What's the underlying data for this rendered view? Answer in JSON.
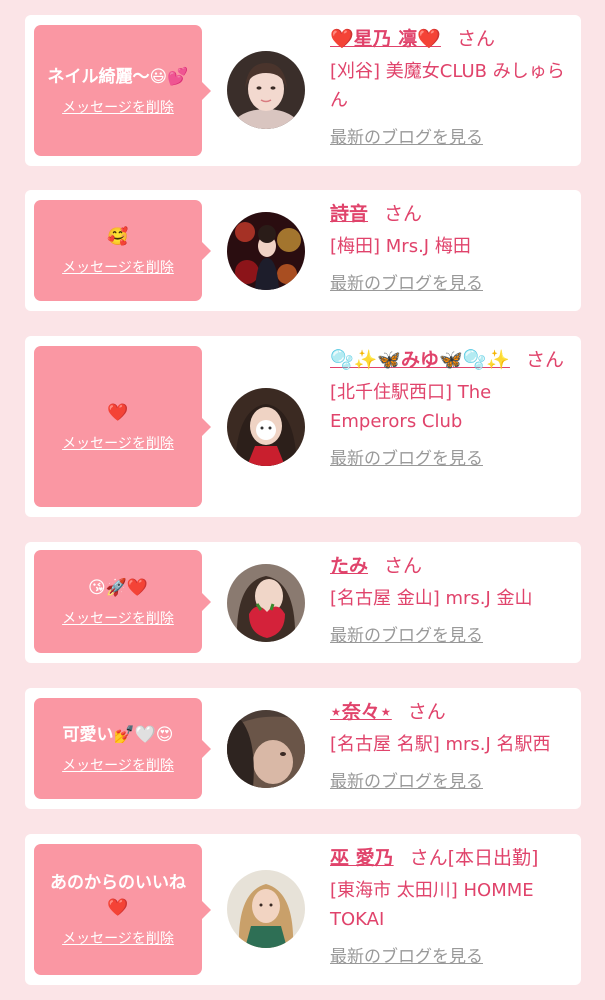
{
  "delete_label": "メッセージを削除",
  "blog_label": "最新のブログを見る",
  "honorific": "さん",
  "colors": {
    "page_background": "#fbe4e7",
    "bubble": "#fa97a3",
    "accent_text": "#e0436b",
    "muted_link": "#999999"
  },
  "messages": [
    {
      "message": "ネイル綺麗〜😃💕",
      "name": "❤️星乃 凛❤️",
      "extra": "",
      "shop": "[刈谷] 美魔女CLUB みしゅらん"
    },
    {
      "message": "🥰",
      "name": "詩音",
      "extra": "",
      "shop": "[梅田] Mrs.J 梅田"
    },
    {
      "message": "❤️",
      "name": "🫧✨🦋みゆ🦋🫧✨",
      "extra": "",
      "shop": "[北千住駅西口] The Emperors Club"
    },
    {
      "message": "😘🚀❤️",
      "name": "たみ",
      "extra": "",
      "shop": "[名古屋 金山] mrs.J 金山"
    },
    {
      "message": "可愛い💅🤍😍",
      "name": "⋆奈々⋆",
      "extra": "",
      "shop": "[名古屋 名駅] mrs.J 名駅西"
    },
    {
      "message": "あのからのいいね❤️",
      "name": "巫 愛乃",
      "extra": "[本日出勤]",
      "shop": "[東海市 太田川] HOMME TOKAI"
    }
  ]
}
